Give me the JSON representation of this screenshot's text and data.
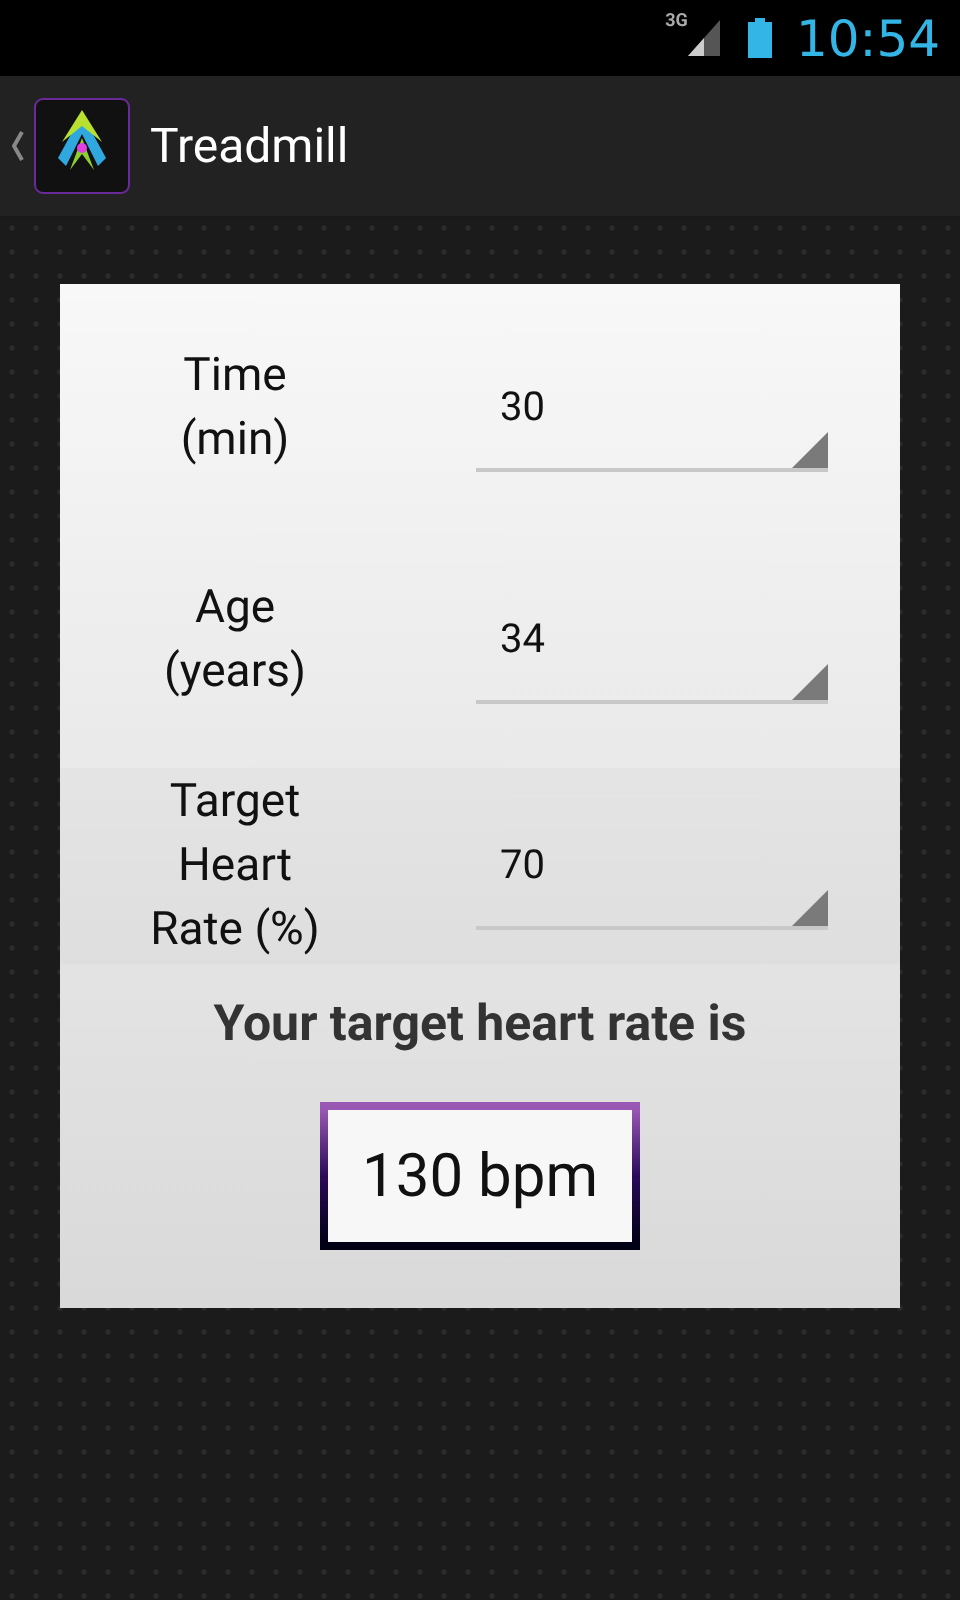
{
  "status_bar": {
    "network": "3G",
    "time": "10:54"
  },
  "action_bar": {
    "title": "Treadmill"
  },
  "fields": [
    {
      "label": "Time\n(min)",
      "value": "30"
    },
    {
      "label": "Age\n(years)",
      "value": "34"
    },
    {
      "label": "Target\nHeart\nRate (%)",
      "value": "70"
    }
  ],
  "result": {
    "heading": "Your target heart rate is",
    "value": "130 bpm"
  }
}
